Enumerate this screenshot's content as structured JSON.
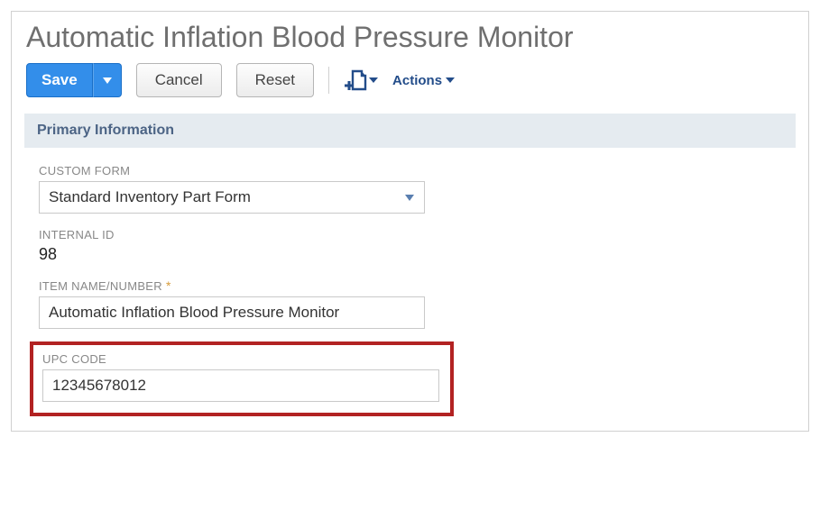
{
  "page_title": "Automatic Inflation Blood Pressure Monitor",
  "toolbar": {
    "save_label": "Save",
    "cancel_label": "Cancel",
    "reset_label": "Reset",
    "actions_label": "Actions"
  },
  "section": {
    "primary_info_heading": "Primary Information"
  },
  "fields": {
    "custom_form": {
      "label": "CUSTOM FORM",
      "value": "Standard Inventory Part Form"
    },
    "internal_id": {
      "label": "INTERNAL ID",
      "value": "98"
    },
    "item_name": {
      "label": "ITEM NAME/NUMBER",
      "value": "Automatic Inflation Blood Pressure Monitor"
    },
    "upc_code": {
      "label": "UPC CODE",
      "value": "12345678012"
    }
  }
}
